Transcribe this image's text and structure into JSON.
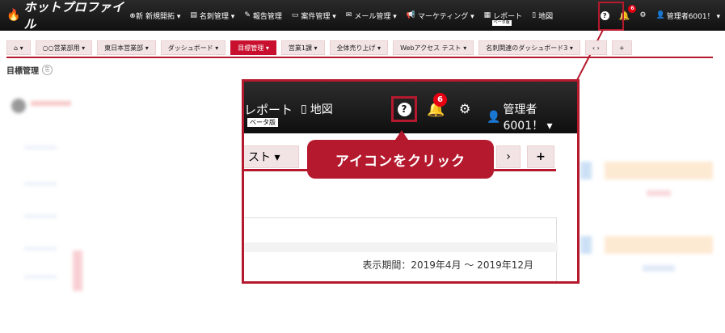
{
  "brand": {
    "name": "ホットプロファイル",
    "tm": "®"
  },
  "nav": {
    "items": [
      {
        "icon": "新",
        "label": "新規開拓 ▾"
      },
      {
        "icon": "▤",
        "label": "名刺管理 ▾"
      },
      {
        "icon": "✎",
        "label": "報告管理"
      },
      {
        "icon": "▭",
        "label": "案件管理 ▾"
      },
      {
        "icon": "✉",
        "label": "メール管理 ▾"
      },
      {
        "icon": "📢",
        "label": "マーケティング ▾"
      },
      {
        "icon": "▦",
        "label": "レポート"
      },
      {
        "icon": "▯",
        "label": "地図"
      }
    ],
    "beta_label": "ベータ版",
    "help_icon": "?",
    "notification_count": "6",
    "gear_icon": "⚙",
    "user_label": "管理者6001！ ▾"
  },
  "tabs": [
    {
      "label": "⌂  ▾"
    },
    {
      "label": "○○営業部用  ▾"
    },
    {
      "label": "東日本営業部  ▾"
    },
    {
      "label": "ダッシュボード  ▾"
    },
    {
      "label": "目標管理  ▾"
    },
    {
      "label": "営業1課  ▾"
    },
    {
      "label": "全体売り上げ  ▾"
    },
    {
      "label": "Webアクセス テスト  ▾"
    },
    {
      "label": "名刺関連のダッシュボード3  ▾"
    },
    {
      "label": "‹  ›"
    },
    {
      "label": "+"
    }
  ],
  "page": {
    "title": "目標管理",
    "clip_icon": "⎘"
  },
  "zoom": {
    "report": "レポート",
    "beta": "ベータ版",
    "map": "地図",
    "help": "?",
    "badge": "6",
    "gear": "⚙",
    "user": "管理者6001！ ▾",
    "tab_label": "スト  ▾",
    "tab_next": "›",
    "tab_plus": "+",
    "callout": "アイコンをクリック",
    "period": "表示期間：2019年4月 ～ 2019年12月"
  },
  "colors": {
    "accent": "#b5192e",
    "nav_bg": "#1a1a1a",
    "tab_bg": "#f2e4e4"
  }
}
